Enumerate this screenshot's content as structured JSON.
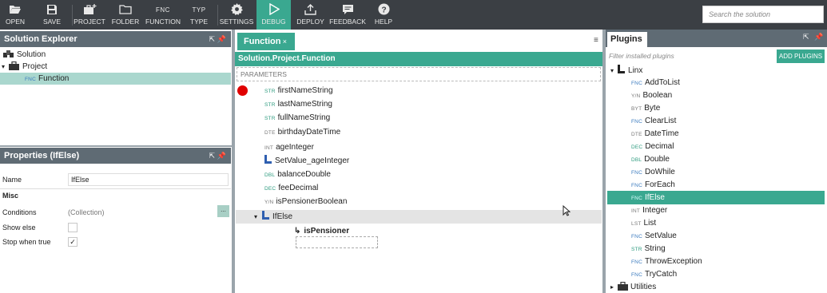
{
  "toolbar": {
    "open": "OPEN",
    "save": "SAVE",
    "project": "PROJECT",
    "folder": "FOLDER",
    "function_tag": "FNC",
    "function": "FUNCTION",
    "type_tag": "TYP",
    "type": "TYPE",
    "settings": "SETTINGS",
    "debug": "DEBUG",
    "deploy": "DEPLOY",
    "feedback": "FEEDBACK",
    "help": "HELP",
    "search_placeholder": "Search the solution",
    "active_color": "#3aa890",
    "bar_color": "#3b3f44"
  },
  "solution_explorer": {
    "title": "Solution Explorer",
    "items": [
      {
        "label": "Solution",
        "icon": "solution-icon"
      },
      {
        "label": "Project",
        "icon": "briefcase-icon"
      },
      {
        "tag": "FNC",
        "label": "Function",
        "selected": true
      }
    ]
  },
  "properties": {
    "title": "Properties (IfElse)",
    "name_label": "Name",
    "name_value": "IfElse",
    "section_misc": "Misc",
    "conditions_label": "Conditions",
    "conditions_value": "(Collection)",
    "conditions_button": "...",
    "show_else_label": "Show else",
    "show_else_checked": false,
    "stop_when_true_label": "Stop when true",
    "stop_when_true_checked": true,
    "check_mark": "✓"
  },
  "editor": {
    "tab_label": "Function",
    "tab_close": "×",
    "breadcrumb": "Solution.Project.Function",
    "parameters_label": "PARAMETERS",
    "rows": [
      {
        "tag": "STR",
        "label": "firstNameString",
        "breakpoint": true
      },
      {
        "tag": "STR",
        "label": "lastNameString"
      },
      {
        "tag": "STR",
        "label": "fullNameString"
      },
      {
        "tag": "DTE",
        "label": "birthdayDateTime"
      },
      {
        "tag": "INT",
        "label": "ageInteger"
      },
      {
        "tag": "",
        "label": "SetValue_ageInteger"
      },
      {
        "tag": "DBL",
        "label": "balanceDouble"
      },
      {
        "tag": "DEC",
        "label": "feeDecimal"
      },
      {
        "tag": "Y/N",
        "label": "isPensionerBoolean"
      }
    ],
    "ifelse_label": "IfElse",
    "condition_label": "isPensioner"
  },
  "plugins": {
    "title": "Plugins",
    "filter_placeholder": "Filter installed plugins",
    "add_button": "ADD PLUGINS",
    "group": "Linx",
    "items": [
      {
        "tag": "FNC",
        "label": "AddToList"
      },
      {
        "tag": "Y/N",
        "label": "Boolean"
      },
      {
        "tag": "BYT",
        "label": "Byte"
      },
      {
        "tag": "FNC",
        "label": "ClearList"
      },
      {
        "tag": "DTE",
        "label": "DateTime"
      },
      {
        "tag": "DEC",
        "label": "Decimal"
      },
      {
        "tag": "DBL",
        "label": "Double"
      },
      {
        "tag": "FNC",
        "label": "DoWhile"
      },
      {
        "tag": "FNC",
        "label": "ForEach"
      },
      {
        "tag": "FNC",
        "label": "IfElse",
        "selected": true
      },
      {
        "tag": "INT",
        "label": "Integer"
      },
      {
        "tag": "LST",
        "label": "List"
      },
      {
        "tag": "FNC",
        "label": "SetValue"
      },
      {
        "tag": "STR",
        "label": "String"
      },
      {
        "tag": "FNC",
        "label": "ThrowException"
      },
      {
        "tag": "FNC",
        "label": "TryCatch"
      }
    ],
    "utilities": "Utilities"
  },
  "icons": {
    "undock": "⇱",
    "pin": "📌",
    "expand": "▾",
    "collapse": "▸",
    "tab_menu": "≡"
  }
}
